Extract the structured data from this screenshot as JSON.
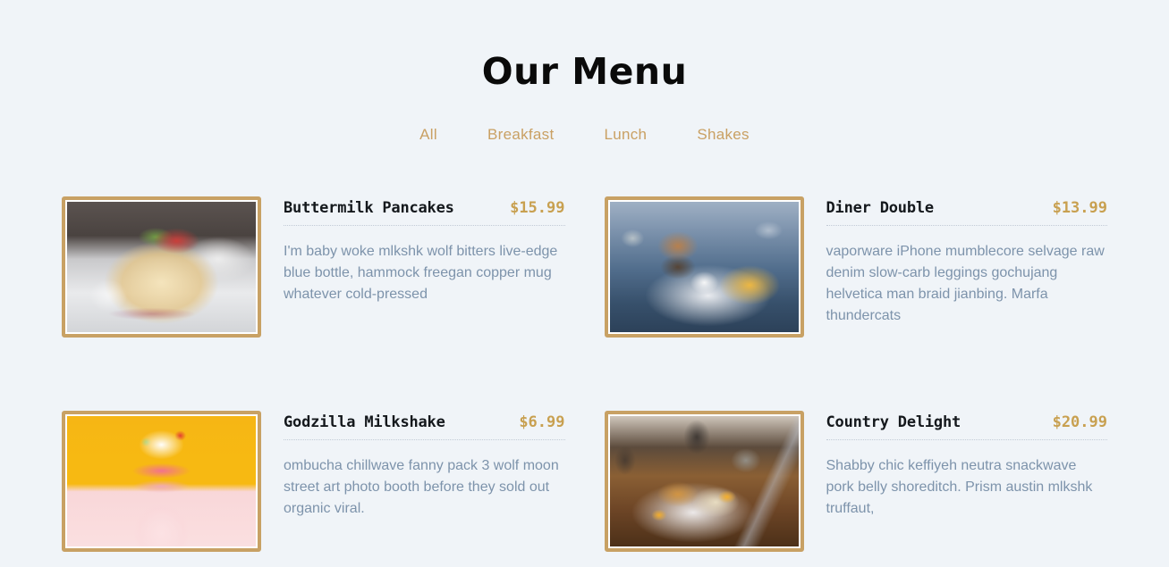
{
  "section": {
    "title": "Our Menu"
  },
  "filters": [
    {
      "label": "All",
      "name": "filter-all"
    },
    {
      "label": "Breakfast",
      "name": "filter-breakfast"
    },
    {
      "label": "Lunch",
      "name": "filter-lunch"
    },
    {
      "label": "Shakes",
      "name": "filter-shakes"
    }
  ],
  "items": [
    {
      "name": "Buttermilk Pancakes",
      "price": "$15.99",
      "description": "I'm baby woke mlkshk wolf bitters live-edge blue bottle, hammock freegan copper mug whatever cold-pressed",
      "image": "pancakes-photo"
    },
    {
      "name": "Diner Double",
      "price": "$13.99",
      "description": "vaporware iPhone mumblecore selvage raw denim slow-carb leggings gochujang helvetica man braid jianbing. Marfa thundercats",
      "image": "burger-photo"
    },
    {
      "name": "Godzilla Milkshake",
      "price": "$6.99",
      "description": "ombucha chillwave fanny pack 3 wolf moon street art photo booth before they sold out organic viral.",
      "image": "milkshake-photo"
    },
    {
      "name": "Country Delight",
      "price": "$20.99",
      "description": "Shabby chic keffiyeh neutra snackwave pork belly shoreditch. Prism austin mlkshk truffaut,",
      "image": "breakfast-photo"
    }
  ],
  "colors": {
    "background": "#f0f4f8",
    "accent_gold": "#c9a063",
    "price_gold": "#c8a050",
    "thumb_border": "#c8a164",
    "title_dark": "#0a0a0a",
    "description_text": "#7d93ab",
    "divider": "#c2cbd6"
  }
}
